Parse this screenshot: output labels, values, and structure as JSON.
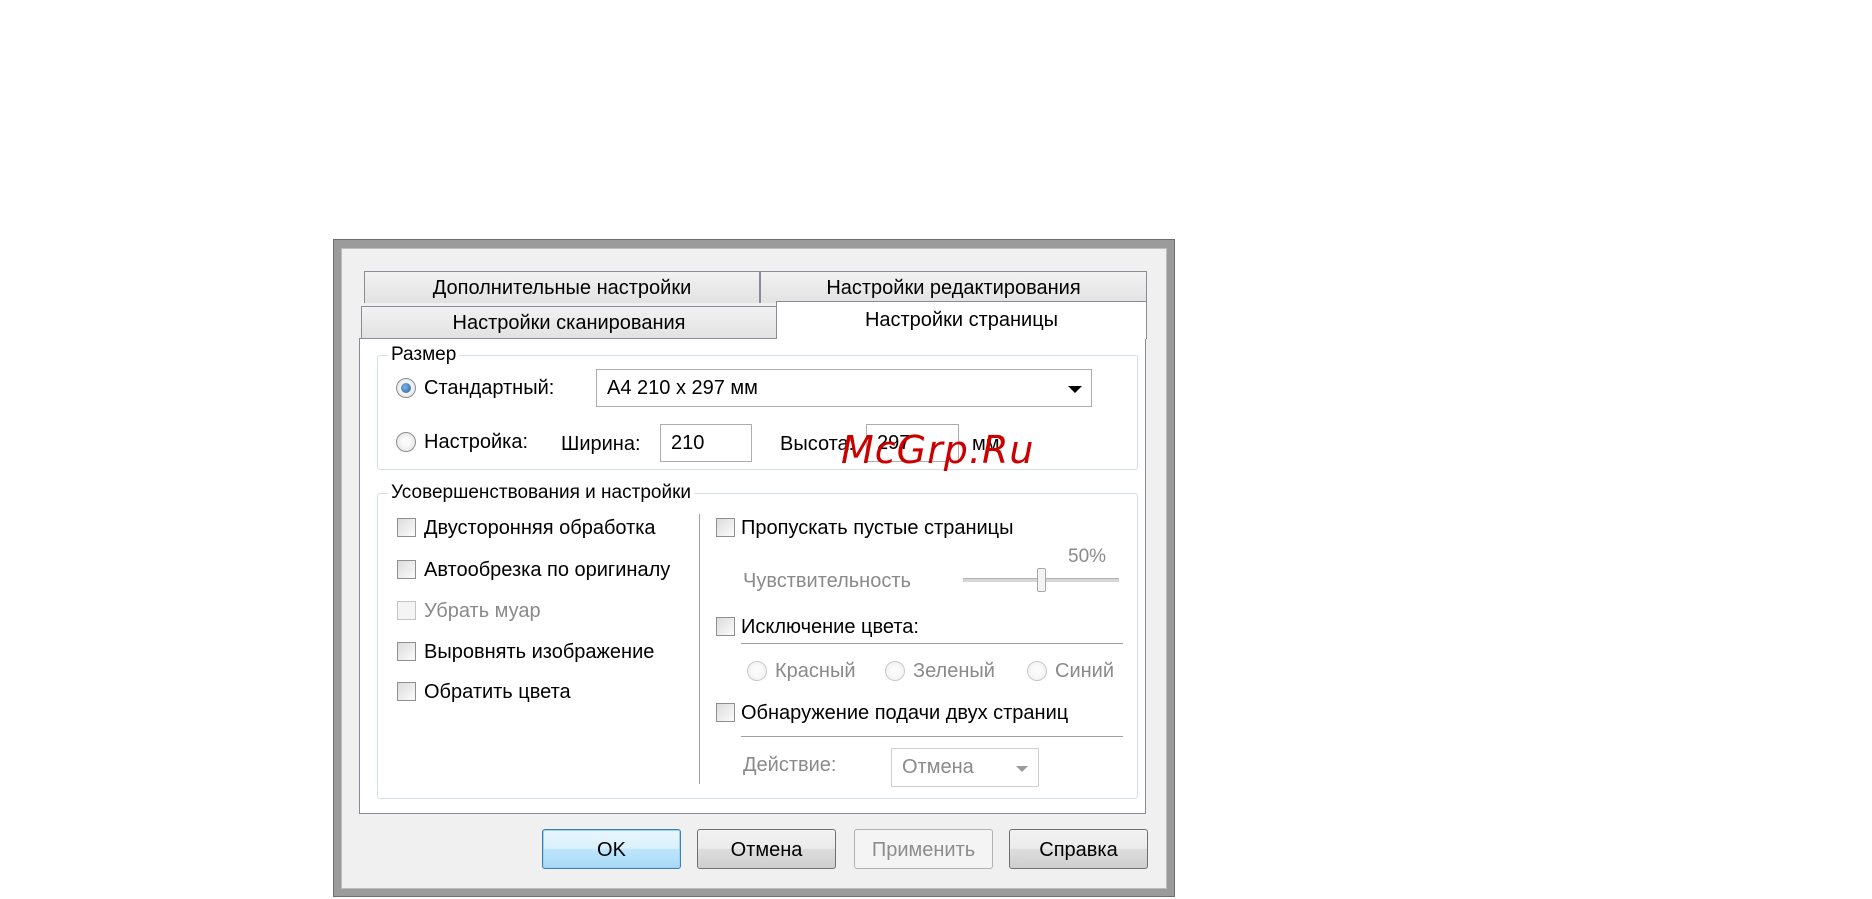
{
  "tabs": {
    "row_back": [
      "Дополнительные настройки",
      "Настройки редактирования"
    ],
    "row_front": [
      "Настройки сканирования",
      "Настройки страницы"
    ],
    "active": "Настройки страницы"
  },
  "size_group": {
    "legend": "Размер",
    "standard_label": "Стандартный:",
    "standard_selected": true,
    "standard_value": "A4 210 x 297 мм",
    "custom_label": "Настройка:",
    "width_label": "Ширина:",
    "width_value": "210",
    "height_label": "Высота:",
    "height_value": "297",
    "unit": "мм"
  },
  "enh_group": {
    "legend": "Усовершенствования и настройки",
    "left_options": [
      {
        "label": "Двусторонняя обработка",
        "checked": false,
        "enabled": true
      },
      {
        "label": "Автообрезка по оригиналу",
        "checked": false,
        "enabled": true
      },
      {
        "label": "Убрать муар",
        "checked": false,
        "enabled": false
      },
      {
        "label": "Выровнять изображение",
        "checked": false,
        "enabled": true
      },
      {
        "label": "Обратить цвета",
        "checked": false,
        "enabled": true
      }
    ],
    "skip_blank": {
      "label": "Пропускать пустые страницы",
      "checked": false
    },
    "sensitivity": {
      "label": "Чувствительность",
      "value_text": "50%",
      "value": 0.5
    },
    "color_drop": {
      "label": "Исключение цвета:",
      "checked": false
    },
    "colors": [
      "Красный",
      "Зеленый",
      "Синий"
    ],
    "double_feed": {
      "label": "Обнаружение подачи двух страниц",
      "checked": false
    },
    "action": {
      "label": "Действие:",
      "value": "Отмена"
    }
  },
  "buttons": {
    "ok": "OK",
    "cancel": "Отмена",
    "apply": "Применить",
    "help": "Справка"
  },
  "watermark": "McGrp.Ru"
}
